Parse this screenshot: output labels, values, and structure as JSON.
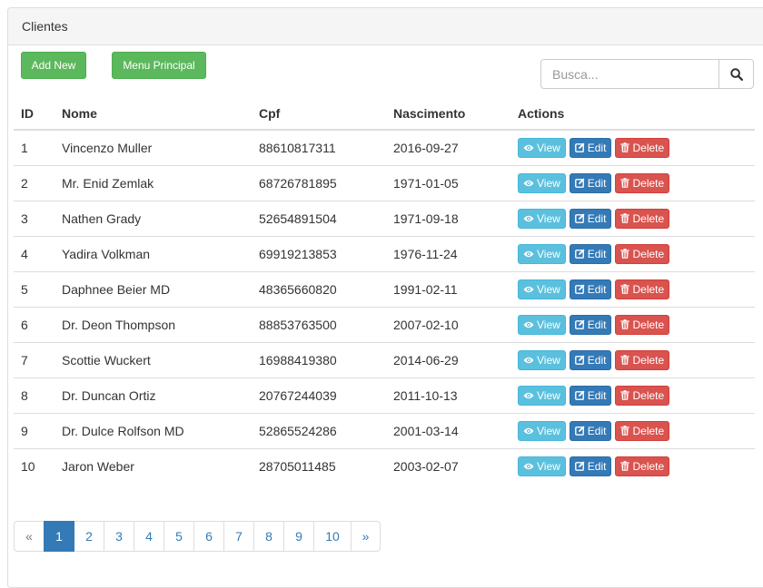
{
  "panel": {
    "title": "Clientes"
  },
  "toolbar": {
    "add_new_label": "Add New",
    "menu_principal_label": "Menu Principal"
  },
  "search": {
    "placeholder": "Busca...",
    "value": "",
    "button_icon": "search-icon"
  },
  "table": {
    "headers": [
      "ID",
      "Nome",
      "Cpf",
      "Nascimento",
      "Actions"
    ],
    "action_labels": {
      "view": "View",
      "edit": "Edit",
      "delete": "Delete"
    },
    "action_icons": {
      "view": "eye-icon",
      "edit": "edit-icon",
      "delete": "trash-icon"
    },
    "rows": [
      [
        "1",
        "Vincenzo Muller",
        "88610817311",
        "2016-09-27"
      ],
      [
        "2",
        "Mr. Enid Zemlak",
        "68726781895",
        "1971-01-05"
      ],
      [
        "3",
        "Nathen Grady",
        "52654891504",
        "1971-09-18"
      ],
      [
        "4",
        "Yadira Volkman",
        "69919213853",
        "1976-11-24"
      ],
      [
        "5",
        "Daphnee Beier MD",
        "48365660820",
        "1991-02-11"
      ],
      [
        "6",
        "Dr. Deon Thompson",
        "88853763500",
        "2007-02-10"
      ],
      [
        "7",
        "Scottie Wuckert",
        "16988419380",
        "2014-06-29"
      ],
      [
        "8",
        "Dr. Duncan Ortiz",
        "20767244039",
        "2011-10-13"
      ],
      [
        "9",
        "Dr. Dulce Rolfson MD",
        "52865524286",
        "2001-03-14"
      ],
      [
        "10",
        "Jaron Weber",
        "28705011485",
        "2003-02-07"
      ]
    ]
  },
  "pagination": {
    "prev": "«",
    "next": "»",
    "pages": [
      "1",
      "2",
      "3",
      "4",
      "5",
      "6",
      "7",
      "8",
      "9",
      "10"
    ],
    "active_page": "1"
  },
  "colors": {
    "success": "#5cb85c",
    "info": "#5bc0de",
    "primary": "#337ab7",
    "danger": "#d9534f"
  }
}
